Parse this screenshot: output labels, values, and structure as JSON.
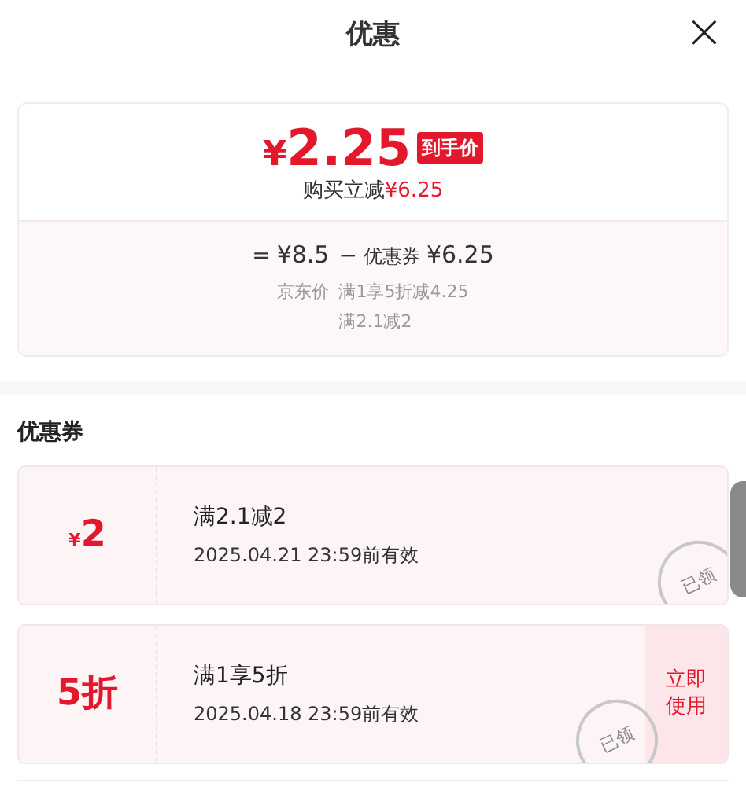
{
  "header": {
    "title": "优惠",
    "close": "×"
  },
  "summary": {
    "currency": "¥",
    "price": "2.25",
    "price_tag": "到手价",
    "saving_label": "购买立减",
    "saving_amount": "¥6.25",
    "breakdown": [
      {
        "operator": "=",
        "amount": "¥8.5",
        "labels": [
          "京东价"
        ]
      },
      {
        "operator": "−",
        "name": "优惠券",
        "amount": "¥6.25",
        "labels": [
          "满1享5折减4.25",
          "满2.1减2"
        ]
      }
    ]
  },
  "coupons_section": {
    "title": "优惠券",
    "coupons": [
      {
        "currency": "¥",
        "amount": "2",
        "condition": "满2.1减2",
        "expiry": "2025.04.21 23:59前有效",
        "stamp": "已领"
      },
      {
        "amount": "5折",
        "condition": "满1享5折",
        "expiry": "2025.04.18 23:59前有效",
        "stamp": "已领",
        "action": "立即使用"
      }
    ]
  }
}
